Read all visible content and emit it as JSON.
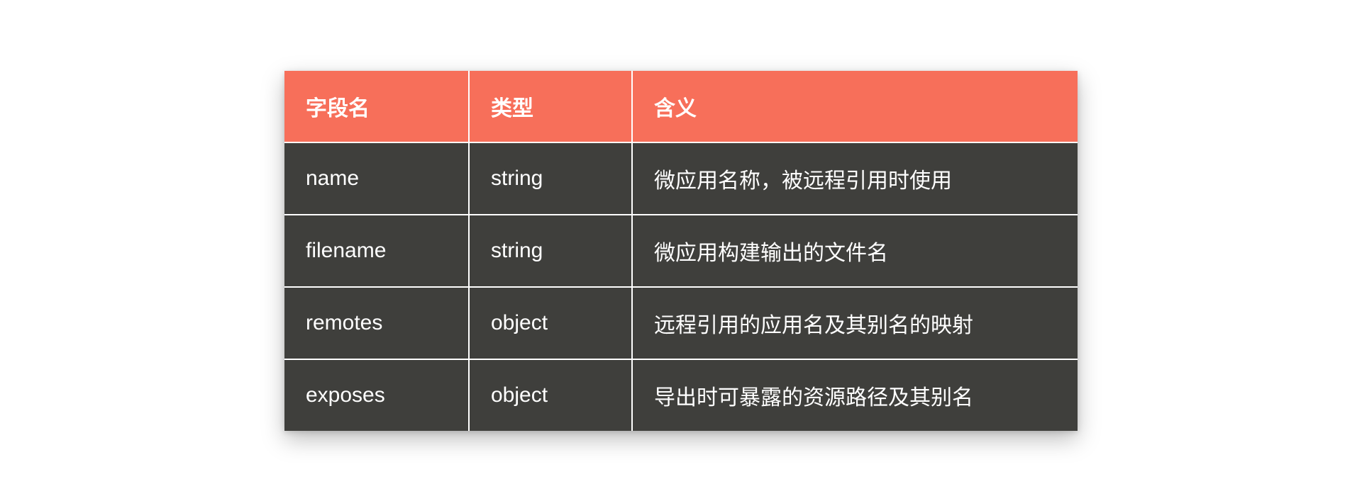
{
  "table": {
    "headers": {
      "field": "字段名",
      "type": "类型",
      "desc": "含义"
    },
    "rows": [
      {
        "field": "name",
        "type": "string",
        "desc": "微应用名称，被远程引用时使用"
      },
      {
        "field": "filename",
        "type": "string",
        "desc": "微应用构建输出的文件名"
      },
      {
        "field": "remotes",
        "type": "object",
        "desc": "远程引用的应用名及其别名的映射"
      },
      {
        "field": "exposes",
        "type": "object",
        "desc": "导出时可暴露的资源路径及其别名"
      }
    ]
  }
}
